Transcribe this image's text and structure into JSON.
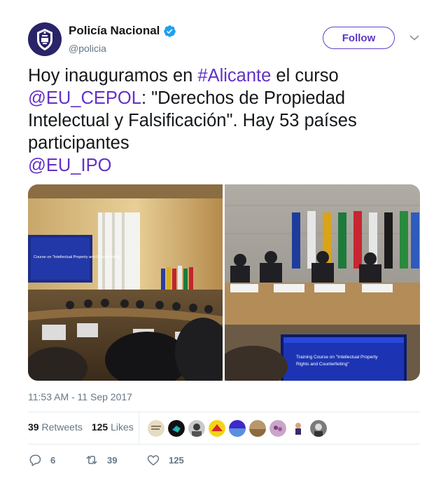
{
  "author": {
    "display_name": "Policía Nacional",
    "handle": "@policia",
    "verified": true,
    "avatar_icon": "policia-nacional-badge-icon"
  },
  "follow_label": "Follow",
  "tweet": {
    "segments": [
      {
        "text": "Hoy inauguramos en ",
        "link": false
      },
      {
        "text": "#Alicante",
        "link": true
      },
      {
        "text": " el curso ",
        "link": false
      },
      {
        "text": "@EU_CEPOL",
        "link": true
      },
      {
        "text": ": \"Derechos de Propiedad Intelectual y Falsificación\". Hay 53 países participantes",
        "link": false
      },
      {
        "text": "@EU_IPO",
        "link": true
      }
    ]
  },
  "media": {
    "left_screen_text": "Course on \"Intellectual Property and Counterfeiting",
    "right_screen_text_1": "Training Course on \"Intellectual Property",
    "right_screen_text_2": "Rights and Counterfeiting\""
  },
  "timestamp": "11:53 AM - 11 Sep 2017",
  "stats": {
    "retweets_count": "39",
    "retweets_label": "Retweets",
    "likes_count": "125",
    "likes_label": "Likes"
  },
  "actions": {
    "reply_count": "6",
    "retweet_count": "39",
    "like_count": "125"
  },
  "colors": {
    "accent": "#5b37c5",
    "link": "#6331c8",
    "verified": "#1da1f2",
    "secondary_text": "#657786"
  }
}
